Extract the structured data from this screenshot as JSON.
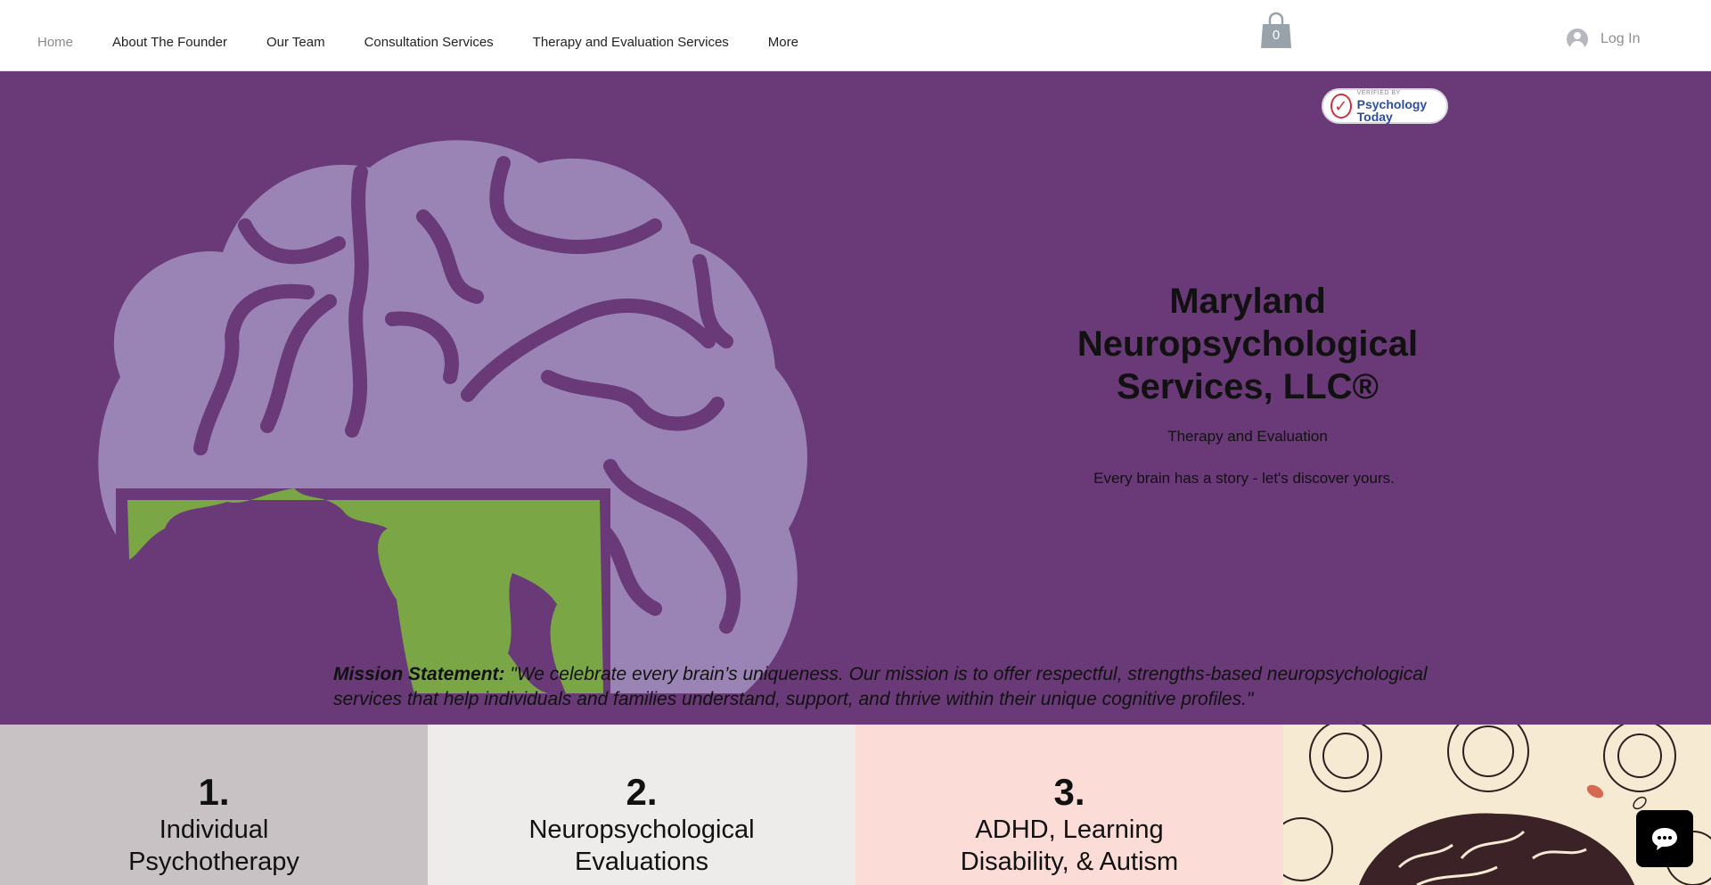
{
  "nav": {
    "items": [
      {
        "label": "Home",
        "active": true
      },
      {
        "label": "About The Founder"
      },
      {
        "label": "Our Team"
      },
      {
        "label": "Consultation Services"
      },
      {
        "label": "Therapy and Evaluation Services"
      },
      {
        "label": "More"
      }
    ],
    "cart_count": "0",
    "login_label": "Log In"
  },
  "hero": {
    "badge": {
      "small_text": "VERIFIED BY",
      "big_text": "Psychology Today"
    },
    "title": "Maryland Neuropsychological Services, LLC®",
    "subtitle": "Therapy and Evaluation",
    "tagline": "Every brain has a story - let's discover yours.",
    "mission_label": "Mission Statement:",
    "mission_text": " \"We celebrate every brain’s uniqueness. Our mission is to offer respectful, strengths-based neuropsychological services that help individuals and families understand, support, and thrive within their unique cognitive profiles.\""
  },
  "services": [
    {
      "number": "1.",
      "title": "Individual Psychotherapy"
    },
    {
      "number": "2.",
      "title": "Neuropsychological Evaluations"
    },
    {
      "number": "3.",
      "title": "ADHD, Learning Disability, & Autism"
    }
  ],
  "colors": {
    "hero_bg": "#693978",
    "brain": "#9a84b6",
    "maryland_green": "#7ba646"
  },
  "icons": [
    "cart-icon",
    "user-avatar-icon",
    "check-icon",
    "chat-icon"
  ]
}
